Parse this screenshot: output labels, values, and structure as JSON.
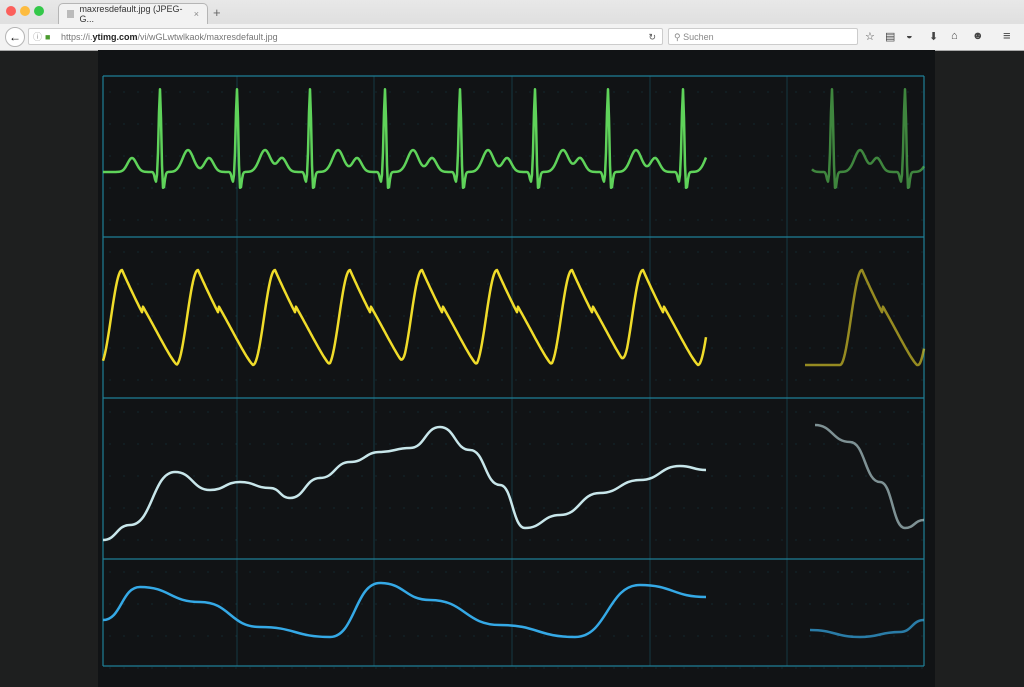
{
  "browser": {
    "tab_title": "maxresdefault.jpg (JPEG-G...",
    "tab_close": "×",
    "new_tab": "+",
    "url_prefix": "https://i.",
    "url_domain": "ytimg.com",
    "url_path": "/vi/wGLwtwlkaok/maxresdefault.jpg",
    "search_placeholder": "Suchen",
    "icons": [
      "back-icon",
      "info-icon",
      "lock-icon",
      "reload-icon",
      "search-icon",
      "bookmark-star-icon",
      "reading-list-icon",
      "pocket-icon",
      "download-icon",
      "home-icon",
      "chat-icon",
      "menu-icon"
    ]
  },
  "monitor": {
    "grid_color": "#1f7f97",
    "traces": [
      {
        "name": "ecg",
        "color": "#5fd35a"
      },
      {
        "name": "pleth",
        "color": "#f0dc2a"
      },
      {
        "name": "respiration",
        "color": "#c8e6ea"
      },
      {
        "name": "pressure",
        "color": "#35a9e6"
      }
    ]
  }
}
